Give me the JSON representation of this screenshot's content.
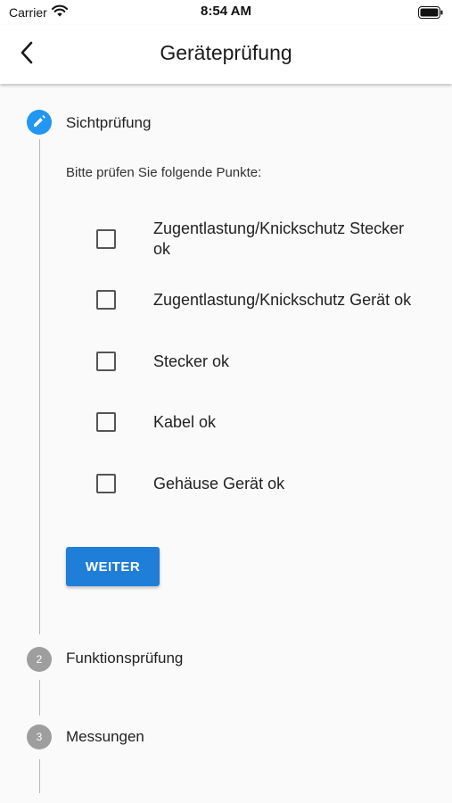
{
  "status_bar": {
    "carrier": "Carrier",
    "time": "8:54 AM",
    "icons": [
      "wifi-icon",
      "battery-icon"
    ]
  },
  "header": {
    "title": "Geräteprüfung",
    "back_icon": "chevron-left-icon"
  },
  "stepper": {
    "accent_color": "#2196f3",
    "inactive_color": "#9e9e9e",
    "steps": [
      {
        "number": "1",
        "icon": "pencil-icon",
        "title": "Sichtprüfung",
        "state": "editing",
        "content": {
          "prompt": "Bitte prüfen Sie folgende Punkte:",
          "checklist": [
            {
              "label": "Zugentlastung/Knickschutz Stecker ok",
              "checked": false
            },
            {
              "label": "Zugentlastung/Knickschutz Gerät ok",
              "checked": false
            },
            {
              "label": "Stecker ok",
              "checked": false
            },
            {
              "label": "Kabel ok",
              "checked": false
            },
            {
              "label": "Gehäuse Gerät ok",
              "checked": false
            }
          ],
          "continue_label": "WEITER",
          "button_color": "#1e7ed8"
        }
      },
      {
        "number": "2",
        "title": "Funktionsprüfung",
        "state": "indexed"
      },
      {
        "number": "3",
        "title": "Messungen",
        "state": "indexed"
      }
    ]
  }
}
